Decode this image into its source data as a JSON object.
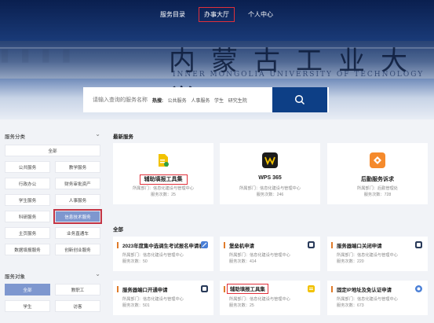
{
  "nav": {
    "items": [
      {
        "label": "服务目录"
      },
      {
        "label": "办事大厅"
      },
      {
        "label": "个人中心"
      }
    ]
  },
  "hero": {
    "calligraphy": "内蒙古工业大学",
    "caption": "INNER MONGOLIA UNIVERSITY OF TECHNOLOGY"
  },
  "search": {
    "placeholder": "请输入查询的服务名称",
    "hot_label": "热搜:",
    "hot_items": [
      "公共服务",
      "人事服务",
      "学生",
      "研究生院"
    ]
  },
  "sidebar": {
    "category_title": "服务分类",
    "categories": [
      "全部",
      "公共服务",
      "教学服务",
      "行政办公",
      "财务审批资产",
      "学生服务",
      "人事服务",
      "科研服务",
      "信息技术服务",
      "主页服务",
      "业务直通车",
      "数据填报服务",
      "创新创业服务"
    ],
    "audience_title": "服务对象",
    "audiences": [
      "全部",
      "教职工",
      "学生",
      "访客"
    ]
  },
  "main": {
    "latest_title": "最新服务",
    "latest": [
      {
        "name": "辅助填报工具集",
        "dept": "所属部门：信息化建设与管理中心",
        "count": "服务次数：25",
        "icon": "tool-icon",
        "color": "#f2c200"
      },
      {
        "name": "WPS 365",
        "dept": "所属部门：信息化建设与管理中心",
        "count": "服务次数：246",
        "icon": "wps-icon",
        "color": "#1c1c1c"
      },
      {
        "name": "后勤服务诉求",
        "dept": "所属部门：后勤管理处",
        "count": "服务次数：728",
        "icon": "logistics-icon",
        "color": "#f58a2c"
      }
    ],
    "all_title": "全部",
    "services": [
      {
        "name": "2023年度集中选调生考试报名申请表",
        "dept": "所属部门：信息化建设与管理中心",
        "count": "服务次数：50",
        "icon_color": "#4a7fd6"
      },
      {
        "name": "堡垒机申请",
        "dept": "所属部门：信息化建设与管理中心",
        "count": "服务次数：414",
        "icon_color": "#2a3b5a"
      },
      {
        "name": "服务器端口关闭申请",
        "dept": "所属部门：信息化建设与管理中心",
        "count": "服务次数：220",
        "icon_color": "#2a3b5a"
      },
      {
        "name": "服务器端口开通申请",
        "dept": "所属部门：信息化建设与管理中心",
        "count": "服务次数：501",
        "icon_color": "#2a3b5a"
      },
      {
        "name": "辅助填报工具集",
        "dept": "所属部门：信息化建设与管理中心",
        "count": "服务次数：25",
        "icon_color": "#f2c200"
      },
      {
        "name": "固定IP地址及免认证申请",
        "dept": "所属部门：信息化建设与管理中心",
        "count": "服务次数：673",
        "icon_color": "#4a7fd6"
      }
    ]
  }
}
